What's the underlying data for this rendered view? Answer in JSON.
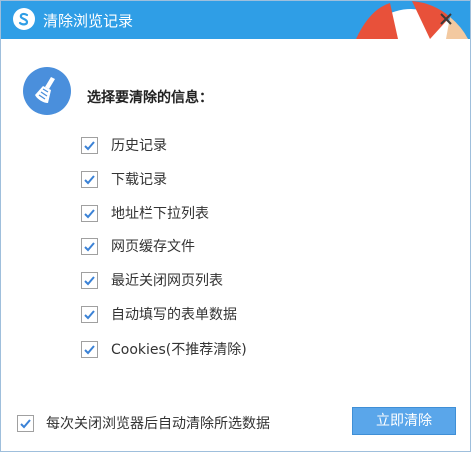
{
  "window": {
    "title": "清除浏览记录"
  },
  "icons": {
    "app": "browser-logo-icon",
    "close": "close-icon",
    "clean": "broom-icon",
    "checkbox": "checkmark-icon"
  },
  "colors": {
    "titlebar": "#2f9ee6",
    "button": "#5aa6ea",
    "check": "#3b82d6"
  },
  "header": {
    "heading": "选择要清除的信息："
  },
  "options": [
    {
      "label": "历史记录",
      "checked": true
    },
    {
      "label": "下载记录",
      "checked": true
    },
    {
      "label": "地址栏下拉列表",
      "checked": true
    },
    {
      "label": "网页缓存文件",
      "checked": true
    },
    {
      "label": "最近关闭网页列表",
      "checked": true
    },
    {
      "label": "自动填写的表单数据",
      "checked": true
    },
    {
      "label": "Cookies(不推荐清除)",
      "checked": true
    }
  ],
  "footer": {
    "auto_clear_label": "每次关闭浏览器后自动清除所选数据",
    "auto_clear_checked": true,
    "clean_button_label": "立即清除"
  }
}
